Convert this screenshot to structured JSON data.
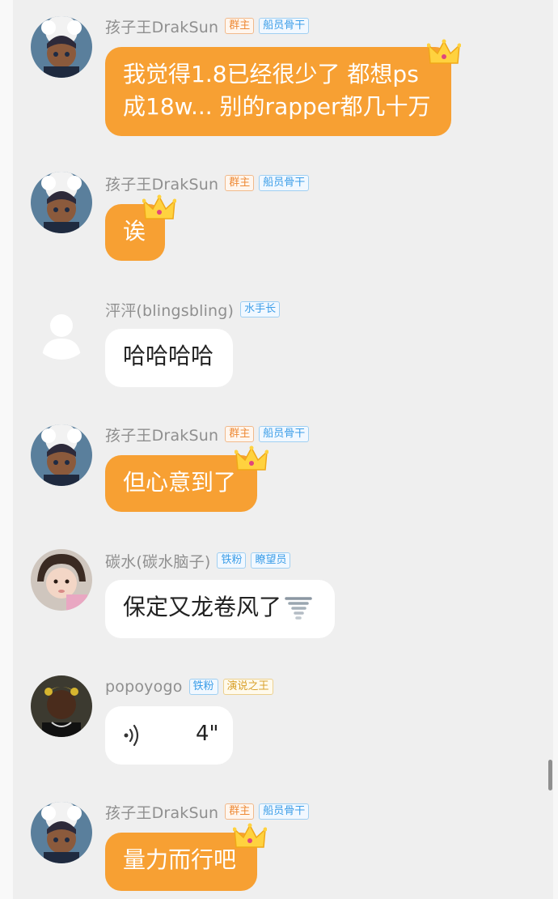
{
  "messages": [
    {
      "sender": "孩子王DrakSun",
      "tags": [
        "群主",
        "船员骨干"
      ],
      "lines": [
        "我觉得1.8已经很少了 都想ps",
        "成18w... 别的rapper都几十万"
      ]
    },
    {
      "sender": "孩子王DrakSun",
      "tags": [
        "群主",
        "船员骨干"
      ],
      "lines": [
        "诶"
      ]
    },
    {
      "sender": "泙泙(blingsbling)",
      "tags": [
        "水手长"
      ],
      "lines": [
        "哈哈哈哈"
      ]
    },
    {
      "sender": "孩子王DrakSun",
      "tags": [
        "群主",
        "船员骨干"
      ],
      "lines": [
        "但心意到了"
      ]
    },
    {
      "sender": "碳水(碳水脑子)",
      "tags": [
        "铁粉",
        "瞭望员"
      ],
      "lines": [
        "保定又龙卷风了"
      ]
    },
    {
      "sender": "popoyogo",
      "tags": [
        "铁粉",
        "演说之王"
      ],
      "voice_duration": "4\""
    },
    {
      "sender": "孩子王DrakSun",
      "tags": [
        "群主",
        "船员骨干"
      ],
      "lines": [
        "量力而行吧"
      ]
    }
  ],
  "colors": {
    "background": "#efefef",
    "owner_bubble": "#f7a033",
    "member_bubble": "#ffffff",
    "name_gray": "#8f8f8f",
    "tag_orange": "#ee8a36",
    "tag_blue": "#3d9ee8",
    "tag_gold": "#d9a12c"
  },
  "icons": {
    "owner_bubble_decoration": "crown-icon",
    "emoji": "tornado-emoji",
    "voice": "voice-wave-icon"
  }
}
